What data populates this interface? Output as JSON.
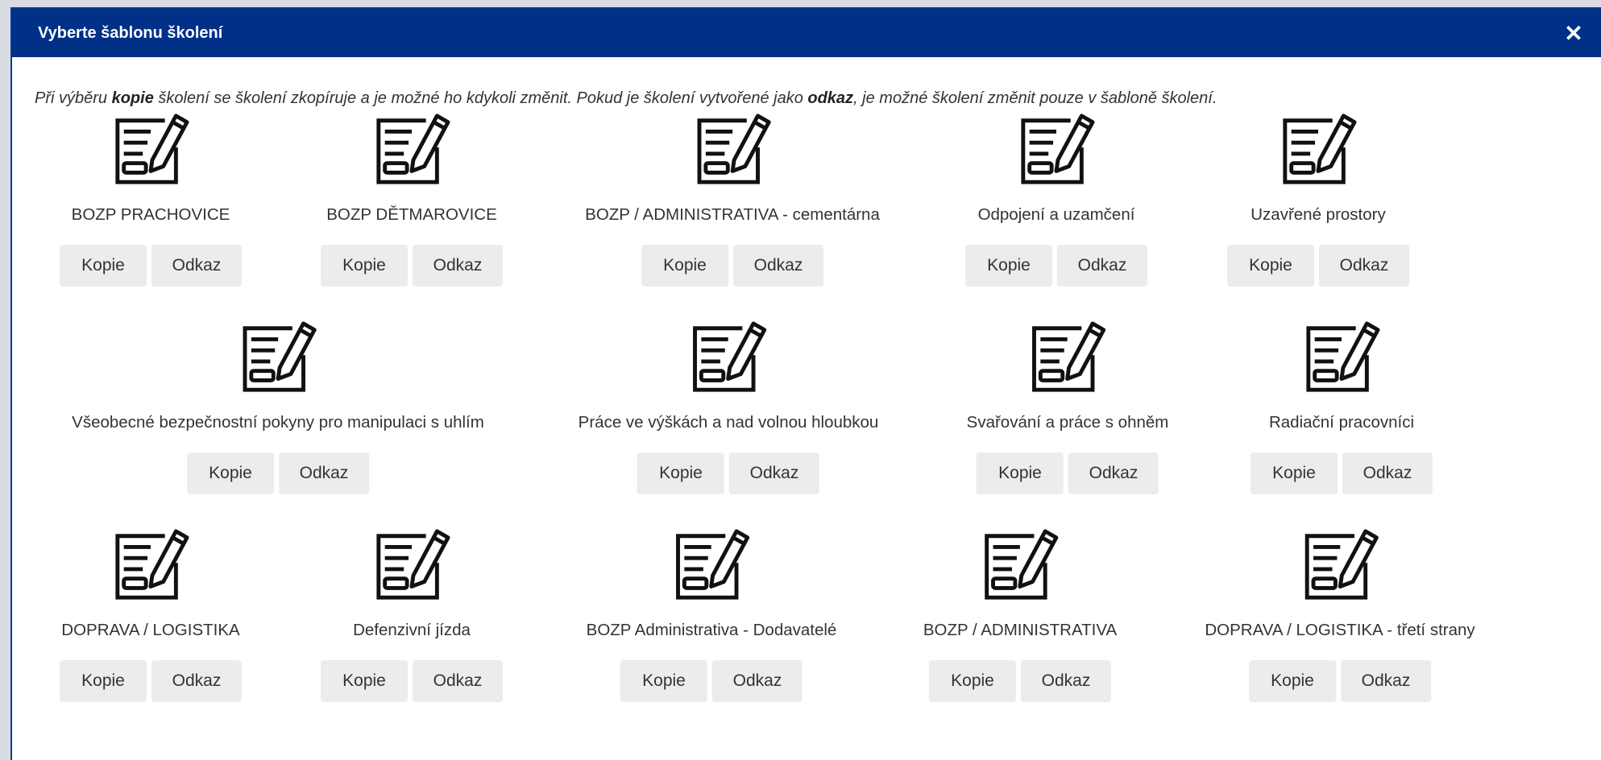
{
  "dialog": {
    "title": "Vyberte šablonu školení",
    "close_label": "✕",
    "info": {
      "part1": "Při výběru ",
      "bold1": "kopie",
      "part2": " školení se školení zkopíruje a je možné ho kdykoli změnit. Pokud je školení vytvořené jako ",
      "bold2": "odkaz",
      "part3": ", je možné školení změnit pouze v šabloně školení."
    }
  },
  "buttons": {
    "copy": "Kopie",
    "link": "Odkaz"
  },
  "templates": [
    {
      "label": "BOZP PRACHOVICE"
    },
    {
      "label": "BOZP DĚTMAROVICE"
    },
    {
      "label": "BOZP / ADMINISTRATIVA - cementárna"
    },
    {
      "label": "Odpojení a uzamčení"
    },
    {
      "label": "Uzavřené prostory"
    },
    {
      "label": "Všeobecné bezpečnostní pokyny pro manipulaci s uhlím"
    },
    {
      "label": "Práce ve výškách a nad volnou hloubkou"
    },
    {
      "label": "Svařování a práce s ohněm"
    },
    {
      "label": "Radiační pracovníci"
    },
    {
      "label": "DOPRAVA / LOGISTIKA"
    },
    {
      "label": "Defenzivní jízda"
    },
    {
      "label": "BOZP Administrativa - Dodavatelé"
    },
    {
      "label": "BOZP / ADMINISTRATIVA"
    },
    {
      "label": "DOPRAVA / LOGISTIKA - třetí strany"
    }
  ],
  "colors": {
    "header": "#003087",
    "button_bg": "#ececec",
    "text": "#333333"
  },
  "icons": {
    "template": "document-edit-icon",
    "close": "close-icon"
  }
}
